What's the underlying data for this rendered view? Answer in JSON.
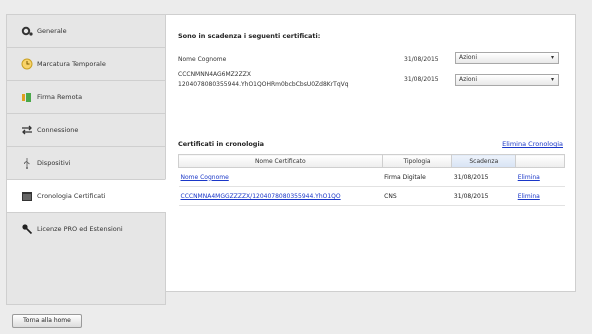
{
  "sidebar": {
    "items": [
      {
        "label": "Generale",
        "icon": "gears-icon"
      },
      {
        "label": "Marcatura Temporale",
        "icon": "clock-icon"
      },
      {
        "label": "Firma Remota",
        "icon": "remote-signature-icon"
      },
      {
        "label": "Connessione",
        "icon": "connection-arrows-icon"
      },
      {
        "label": "Dispositivi",
        "icon": "usb-icon"
      },
      {
        "label": "Cronologia Certificati",
        "icon": "calendar-icon",
        "active": true
      },
      {
        "label": "Licenze PRO ed Estensioni",
        "icon": "keys-icon"
      }
    ]
  },
  "expiring": {
    "title": "Sono in scadenza i seguenti certificati:",
    "rows": [
      {
        "name": "Nome Cognome",
        "name_line2": "",
        "date": "31/08/2015",
        "action": "Azioni"
      },
      {
        "name": "CCCNMNN4AG6MZ2ZZX",
        "name_line2": "1204078080355944.YhO1QOHRm0bcbCbsU0Zd8KrTqVq",
        "date": "31/08/2015",
        "action": "Azioni"
      }
    ]
  },
  "history": {
    "title": "Certificati in cronologia",
    "clear_link": "Elimina Cronologia",
    "columns": [
      "Nome Certificato",
      "Tipologia",
      "Scadenza",
      ""
    ],
    "rows": [
      {
        "name": "Nome Cognome",
        "type": "Firma Digitale",
        "expiry": "31/08/2015",
        "action": "Elimina"
      },
      {
        "name": "CCCNMNA4MGGZZZZX/1204078080355944.YhO1QO",
        "type": "CNS",
        "expiry": "31/08/2015",
        "action": "Elimina"
      }
    ]
  },
  "footer": {
    "home_button": "Torna alla home"
  },
  "colors": {
    "link": "#1a37c8",
    "panel": "#ffffff",
    "background": "#ececec"
  }
}
